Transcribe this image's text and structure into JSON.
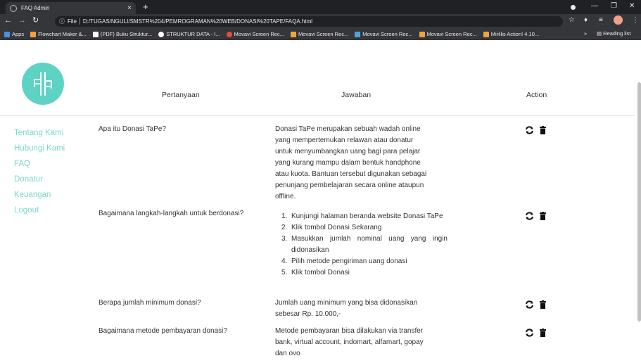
{
  "browser": {
    "tab_title": "FAQ Admin",
    "tab_close": "×",
    "new_tab": "+",
    "omnibox": {
      "scheme": "File",
      "url": "D:/TUGAS/NGULI/SMSTR%204/PEMROGRAMAN%20WEB/DONASI%20TAPE/FAQA.html"
    },
    "bookmarks": [
      {
        "label": "Apps",
        "color": "#4a90e2"
      },
      {
        "label": "Flowchart Maker &...",
        "color": "#f2a33a"
      },
      {
        "label": "(PDF) Buku Struktur...",
        "color": "#ffffff"
      },
      {
        "label": "STRUKTUR DATA - I...",
        "color": "#ffffff"
      },
      {
        "label": "Movavi Screen Rec...",
        "color": "#e94b3c"
      },
      {
        "label": "Movavi Screen Rec...",
        "color": "#f2a33a"
      },
      {
        "label": "Movavi Screen Rec...",
        "color": "#4aa3df"
      },
      {
        "label": "Movavi Screen Rec...",
        "color": "#f2a33a"
      },
      {
        "label": "Mirillis Action! 4.10...",
        "color": "#f2a33a"
      }
    ],
    "bookmarks_overflow": "»",
    "reading_list": "Reading list"
  },
  "page": {
    "menu": [
      "Tentang Kami",
      "Hubungi Kami",
      "FAQ",
      "Donatur",
      "Keuangan",
      "Logout"
    ],
    "columns": {
      "question": "Pertanyaan",
      "answer": "Jawaban",
      "action": "Action"
    },
    "rows": [
      {
        "question": "Apa itu Donasi TaPe?",
        "answer_lines": [
          "Donasi TaPe merupakan sebuah wadah online",
          "yang mempertemukan relawan atau donatur",
          "untuk menyumbangkan uang bagi para pelajar",
          "yang kurang mampu dalam bentuk handphone",
          "atau kuota. Bantuan tersebut digunakan sebagai",
          "penunjang pembelajaran secara online ataupun",
          "offline."
        ]
      },
      {
        "question": "Bagaimana langkah-langkah untuk berdonasi?",
        "answer_list": [
          {
            "num": "1.",
            "text": "Kunjungi halaman beranda website Donasi TaPe"
          },
          {
            "num": "2.",
            "text": "Klik tombol Donasi Sekarang"
          },
          {
            "num": "3.",
            "text": "Masukkan jumlah nominal uang yang ingin didonasikan"
          },
          {
            "num": "4.",
            "text": "Pilih metode pengiriman uang donasi"
          },
          {
            "num": "5.",
            "text": "Klik tombol Donasi"
          }
        ]
      },
      {
        "question": "Berapa jumlah minimum donasi?",
        "answer_lines": [
          "Jumlah uang minimum yang bisa didonasikan",
          "sebesar Rp. 10.000,-"
        ]
      },
      {
        "question": "Bagaimana metode pembayaran donasi?",
        "answer_lines": [
          "Metode pembayaran bisa dilakukan via transfer",
          "bank, virtual account, indomart, alfamart, gopay",
          "dan ovo"
        ]
      }
    ]
  },
  "colors": {
    "accent": "#5fd2c6",
    "menu_text": "#79d9cf",
    "chrome_dark": "#202124",
    "chrome": "#35363a"
  },
  "icons": {
    "edit": "refresh-icon",
    "delete": "trash-icon"
  }
}
